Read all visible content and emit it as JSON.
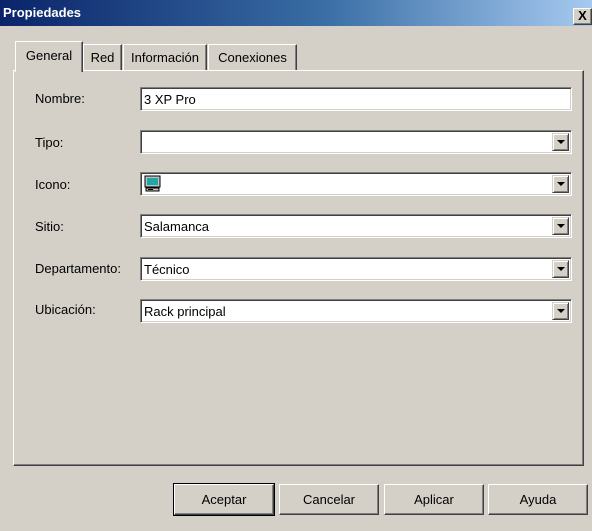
{
  "window": {
    "title": "Propiedades",
    "close_label": "X"
  },
  "tabs": [
    {
      "label": "General",
      "active": true
    },
    {
      "label": "Red"
    },
    {
      "label": "Información"
    },
    {
      "label": "Conexiones"
    }
  ],
  "form": {
    "nombre": {
      "label": "Nombre:",
      "value": "3 XP Pro"
    },
    "tipo": {
      "label": "Tipo:",
      "value": ""
    },
    "icono": {
      "label": "Icono:",
      "icon": "computer-icon"
    },
    "sitio": {
      "label": "Sitio:",
      "value": "Salamanca"
    },
    "departamento": {
      "label": "Departamento:",
      "value": "Técnico"
    },
    "ubicacion": {
      "label": "Ubicación:",
      "value": "Rack principal"
    }
  },
  "buttons": {
    "aceptar": "Aceptar",
    "cancelar": "Cancelar",
    "aplicar": "Aplicar",
    "ayuda": "Ayuda"
  },
  "colors": {
    "titlebar_start": "#0a246a",
    "titlebar_end": "#a6caf0",
    "face": "#d4d0c8"
  }
}
